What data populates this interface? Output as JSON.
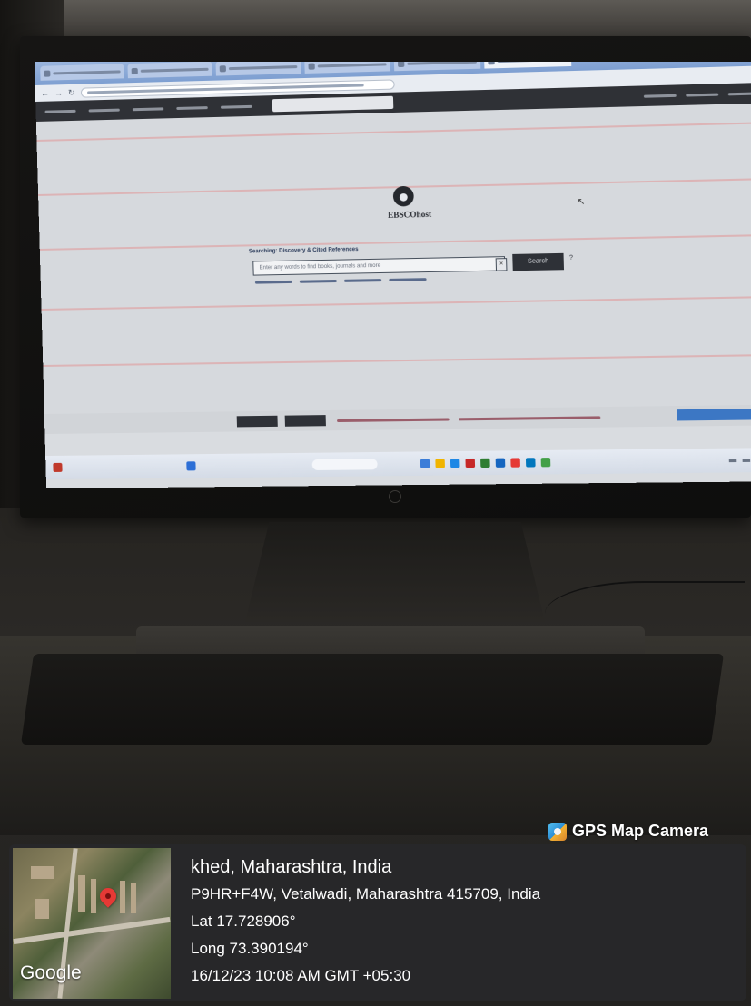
{
  "photo": {
    "monitor_screen": {
      "app": "EBSCOhost",
      "logo_text": "EBSCOhost",
      "search_label": "Searching: Discovery & Cited References",
      "search_placeholder": "Enter any words to find books, journals and more",
      "search_button": "Search",
      "clear_icon": "x-icon",
      "help_icon": "question-icon",
      "accent_color": "#2e3137"
    }
  },
  "overlay": {
    "app_name": "GPS Map Camera",
    "place": "khed, Maharashtra, India",
    "address": "P9HR+F4W, Vetalwadi, Maharashtra 415709, India",
    "latitude": "Lat 17.728906°",
    "longitude": "Long 73.390194°",
    "timestamp": "16/12/23 10:08 AM GMT +05:30",
    "map_attribution": "Google",
    "pin_color": "#e53935"
  }
}
